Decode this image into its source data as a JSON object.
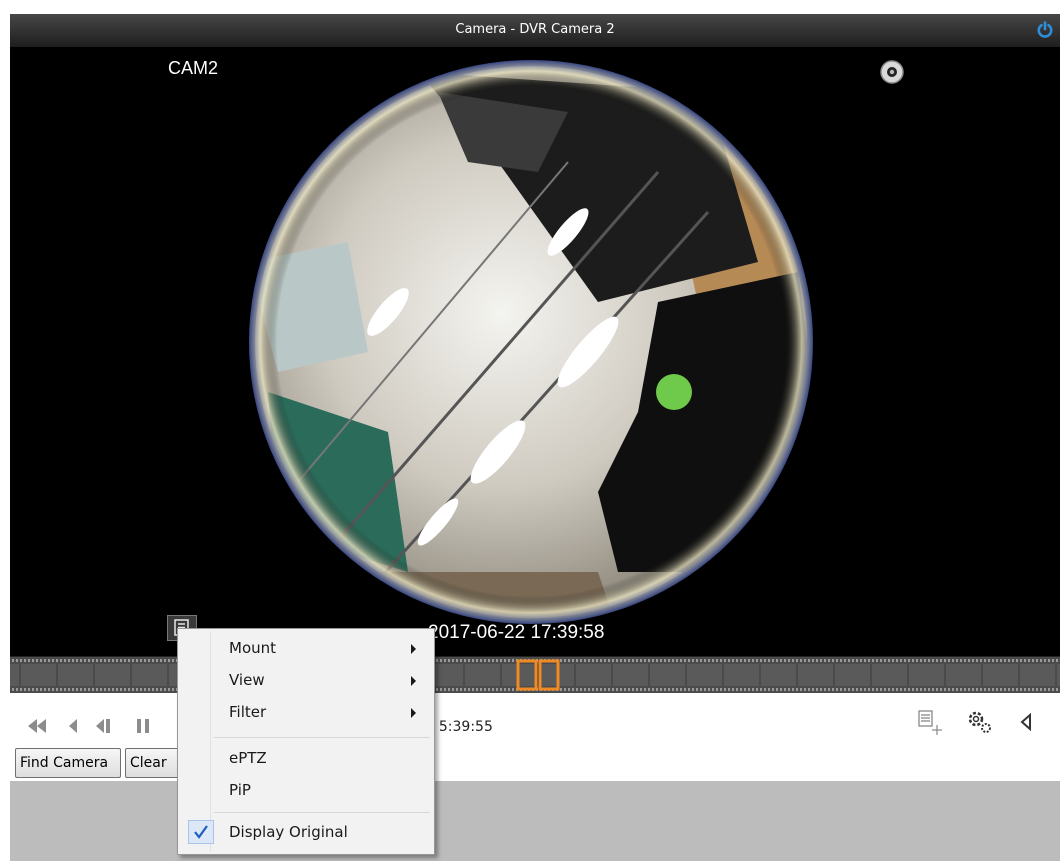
{
  "window": {
    "title": "Camera - DVR Camera 2"
  },
  "video": {
    "camera_label": "CAM2",
    "timestamp": "2017-06-22 17:39:58"
  },
  "playback": {
    "time_display": ", 5:39:55",
    "buttons": [
      "fast-rewind-icon",
      "rewind-icon",
      "step-back-icon",
      "pause-icon"
    ]
  },
  "footer": {
    "find_camera_label": "Find Camera",
    "clear_label": "Clear"
  },
  "context_menu": {
    "items": [
      {
        "label": "Mount",
        "submenu": true
      },
      {
        "label": "View",
        "submenu": true
      },
      {
        "label": "Filter",
        "submenu": true
      },
      {
        "label": "ePTZ",
        "submenu": false
      },
      {
        "label": "PiP",
        "submenu": false
      },
      {
        "label": "Display Original",
        "checked": true
      }
    ]
  },
  "colors": {
    "title_bar": "#2b2b2b",
    "accent_blue": "#2e8fd8",
    "timeline_marker": "#f08a24",
    "check_blue": "#1e5fbf"
  }
}
